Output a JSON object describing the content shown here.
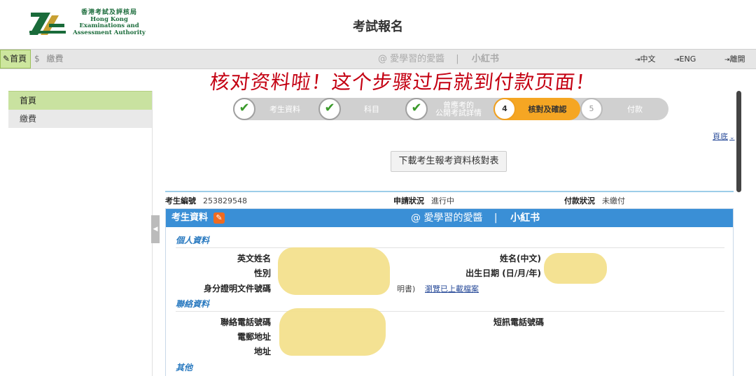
{
  "header": {
    "logo_zh": "香港考試及評核局",
    "logo_en": [
      "Hong Kong",
      "Examinations and",
      "Assessment Authority"
    ],
    "title": "考試報名"
  },
  "topnav": {
    "home": "首頁",
    "pay_icon": "$",
    "pay": "繳費",
    "watermark": "@ 愛學習的愛醬",
    "watermark_sep": "|",
    "watermark_brand": "小紅书",
    "lang_zh": "中文",
    "lang_en": "ENG",
    "logout": "離開"
  },
  "banner": "核对资料啦！这个步骤过后就到付款页面！",
  "sidebar": {
    "items": [
      {
        "label": "首頁"
      },
      {
        "label": "繳費"
      }
    ]
  },
  "steps": [
    {
      "label": "考生資料",
      "state": "done",
      "num": "✔"
    },
    {
      "label": "科目",
      "state": "done",
      "num": "✔"
    },
    {
      "label": "曾應考的公開考試詳情",
      "label_line1": "曾應考的",
      "label_line2": "公開考試詳情",
      "state": "done",
      "num": "✔"
    },
    {
      "label": "核對及確認",
      "state": "current",
      "num": "4"
    },
    {
      "label": "付款",
      "state": "todo",
      "num": "5"
    }
  ],
  "page_bottom_link": "頁底",
  "download_button": "下載考生報考資料核對表",
  "status": {
    "candidate_no_label": "考生編號",
    "candidate_no": "253829548",
    "application_label": "申請狀況",
    "application": "進行中",
    "payment_label": "付款狀況",
    "payment": "未繳付"
  },
  "panel": {
    "title": "考生資料",
    "watermark": "@ 愛學習的愛醬",
    "watermark_sep": "|",
    "watermark_brand": "小紅书",
    "sections": {
      "personal": "個人資料",
      "contact": "聯絡資料",
      "other": "其他"
    },
    "fields": {
      "english_name": "英文姓名",
      "chinese_name": "姓名(中文)",
      "gender": "性別",
      "dob": "出生日期 (日/月/年)",
      "id_doc": "身分證明文件號碼",
      "id_suffix": "明書)",
      "uploaded_link": "瀏覽已上載檔案",
      "phone": "聯絡電話號碼",
      "sms_phone": "短訊電話號碼",
      "email": "電郵地址",
      "address": "地址"
    }
  },
  "colors": {
    "accent_blue": "#3a8fd6",
    "step_active": "#f5a623",
    "banner_red": "#c40012",
    "sidebar_active": "#c9e2a0"
  }
}
